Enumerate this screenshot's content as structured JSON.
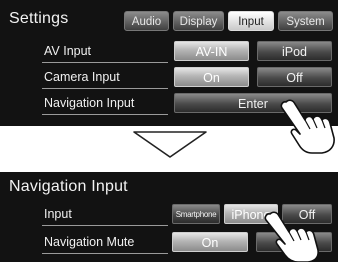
{
  "settings": {
    "title": "Settings",
    "tabs": [
      {
        "label": "Audio",
        "active": false
      },
      {
        "label": "Display",
        "active": false
      },
      {
        "label": "Input",
        "active": true
      },
      {
        "label": "System",
        "active": false
      }
    ],
    "rows": [
      {
        "label": "AV Input",
        "options": [
          "AV-IN",
          "iPod"
        ],
        "selected": "AV-IN"
      },
      {
        "label": "Camera Input",
        "options": [
          "On",
          "Off"
        ],
        "selected": "On"
      },
      {
        "label": "Navigation Input",
        "options": [
          "Enter"
        ],
        "selected": "Enter"
      }
    ]
  },
  "navigation_input": {
    "title": "Navigation Input",
    "rows": [
      {
        "label": "Input",
        "options": [
          "Smartphone",
          "iPhone",
          "Off"
        ],
        "selected": "iPhone"
      },
      {
        "label": "Navigation Mute",
        "options": [
          "On",
          "Off"
        ],
        "selected": "On"
      }
    ]
  },
  "icons": {
    "transition": "down-arrow-icon",
    "pointer": "hand-pointer-icon"
  },
  "colors": {
    "panel_background": "#121212",
    "text": "#f2f2f2",
    "button_selected": "#b5b5b5",
    "button_unselected": "#4a4a4a"
  }
}
